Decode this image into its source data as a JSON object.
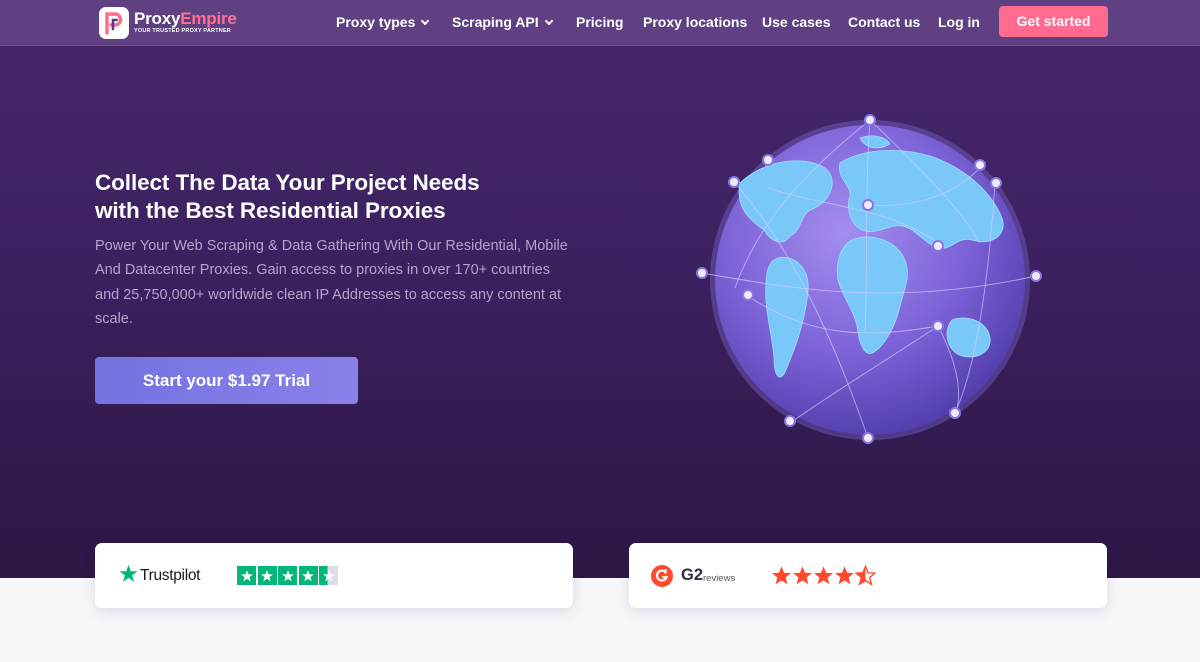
{
  "brand": {
    "name_main": "Proxy",
    "name_accent": "Empire",
    "tagline": "YOUR TRUSTED PROXY PARTNER",
    "accent_color": "#ff6b8f"
  },
  "nav": {
    "items": [
      {
        "label": "Proxy types",
        "has_dropdown": true
      },
      {
        "label": "Scraping API",
        "has_dropdown": true
      },
      {
        "label": "Pricing",
        "has_dropdown": false
      },
      {
        "label": "Proxy locations",
        "has_dropdown": false
      },
      {
        "label": "Use cases",
        "has_dropdown": false
      },
      {
        "label": "Contact us",
        "has_dropdown": false
      },
      {
        "label": "Log in",
        "has_dropdown": false
      }
    ],
    "cta_label": "Get started"
  },
  "hero": {
    "headline_line1": "Collect The Data Your Project Needs",
    "headline_line2": "with the Best Residential Proxies",
    "subtext": "Power Your Web Scraping & Data Gathering With Our Residential, Mobile And Datacenter Proxies. Gain access to proxies in over 170+ countries and 25,750,000+ worldwide clean IP Addresses to access any content at scale.",
    "cta_label": "Start your $1.97 Trial",
    "illustration": "globe-network-icon"
  },
  "reviews": {
    "trustpilot": {
      "name": "Trustpilot",
      "icon": "trustpilot-star-icon",
      "rating": 4.5,
      "max": 5
    },
    "g2": {
      "name": "G2",
      "sub": "reviews",
      "icon": "g2-logo-icon",
      "rating": 4.5,
      "max": 5
    }
  }
}
